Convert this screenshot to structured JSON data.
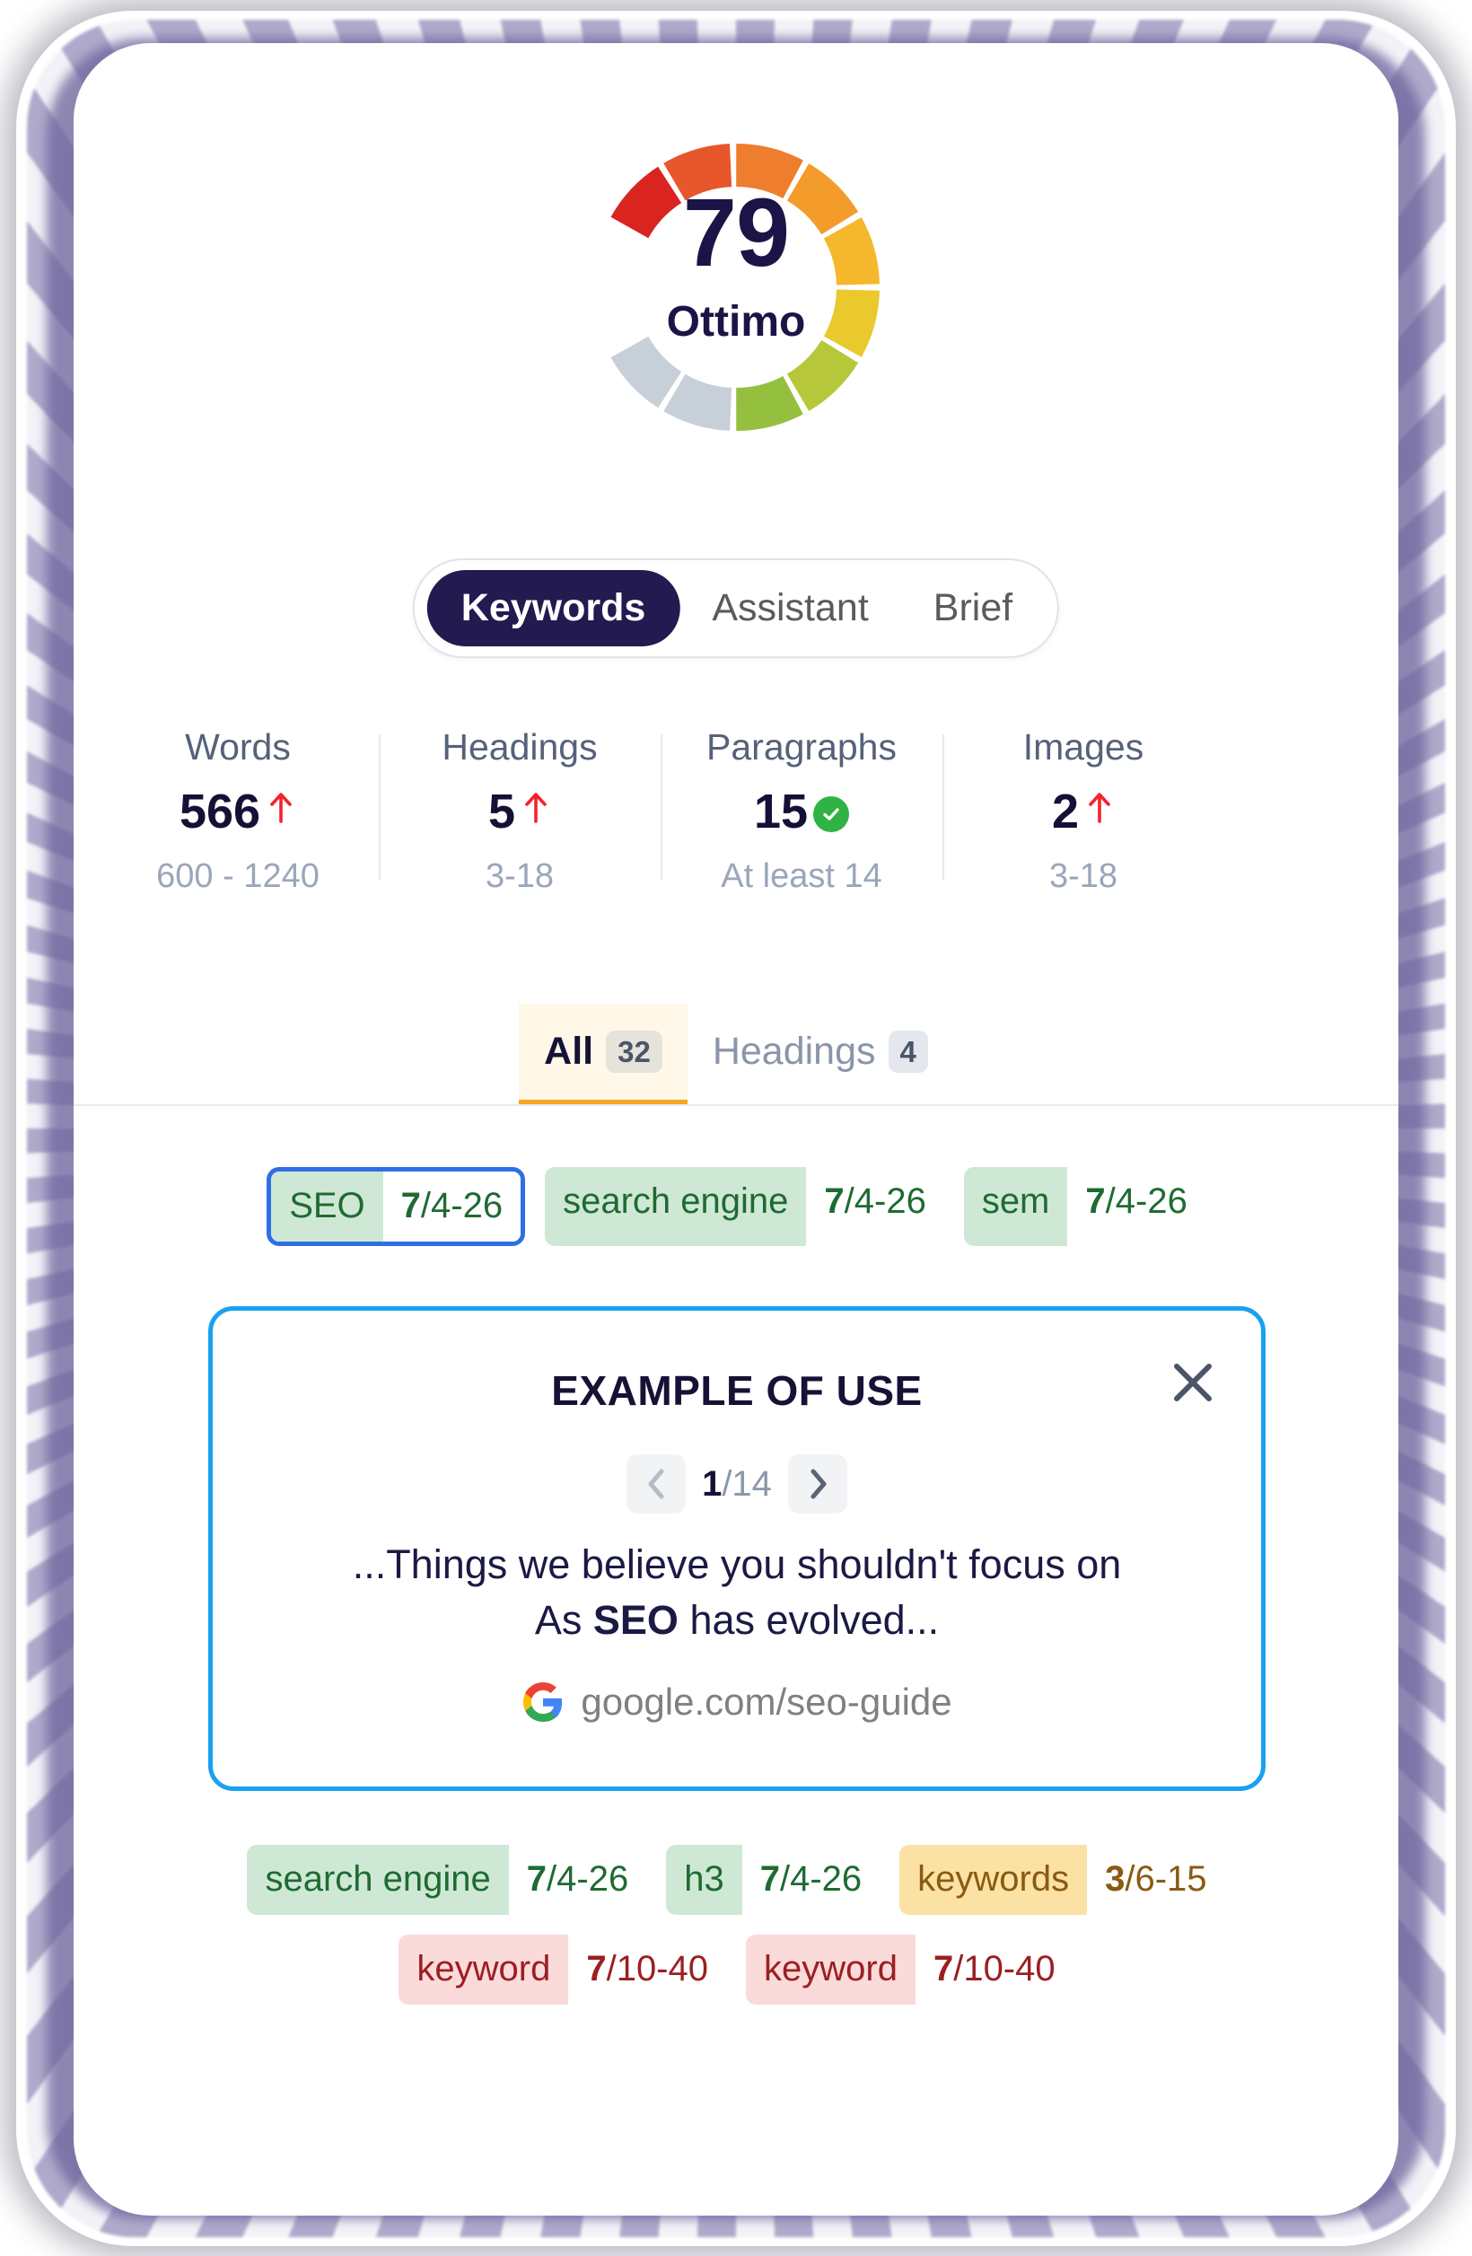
{
  "gauge": {
    "score": "79",
    "label": "Ottimo",
    "score_color": "#1b1547",
    "segments": [
      {
        "color": "#d92420"
      },
      {
        "color": "#e8562c"
      },
      {
        "color": "#ee7d2d"
      },
      {
        "color": "#f39c2b"
      },
      {
        "color": "#f5b72b"
      },
      {
        "color": "#e9c92c"
      },
      {
        "color": "#b6c83a"
      },
      {
        "color": "#95bf3f"
      },
      {
        "color": "#c7d0d8"
      },
      {
        "color": "#c7d0d8"
      }
    ],
    "filled_count": 8
  },
  "tabs": [
    {
      "label": "Keywords",
      "active": true
    },
    {
      "label": "Assistant",
      "active": false
    },
    {
      "label": "Brief",
      "active": false
    }
  ],
  "stats": [
    {
      "name": "Words",
      "value": "566",
      "indicator": "arrow-up-icon",
      "range": "600 - 1240"
    },
    {
      "name": "Headings",
      "value": "5",
      "indicator": "arrow-up-icon",
      "range": "3-18"
    },
    {
      "name": "Paragraphs",
      "value": "15",
      "indicator": "check-circle-icon",
      "range": "At least 14"
    },
    {
      "name": "Images",
      "value": "2",
      "indicator": "arrow-up-icon",
      "range": "3-18"
    }
  ],
  "filters": [
    {
      "label": "All",
      "count": "32",
      "active": true
    },
    {
      "label": "Headings",
      "count": "4",
      "active": false
    }
  ],
  "chip_rows": [
    [
      {
        "term": "SEO",
        "used": "7",
        "target": "/4-26",
        "tone": "green",
        "selected": true
      },
      {
        "term": "search engine",
        "used": "7",
        "target": "/4-26",
        "tone": "green",
        "selected": false
      },
      {
        "term": "sem",
        "used": "7",
        "target": "/4-26",
        "tone": "green",
        "selected": false
      }
    ],
    [
      {
        "term": "search engine",
        "used": "7",
        "target": "/4-26",
        "tone": "green",
        "selected": false
      },
      {
        "term": "h3",
        "used": "7",
        "target": "/4-26",
        "tone": "green",
        "selected": false
      },
      {
        "term": "keywords",
        "used": "3",
        "target": "/6-15",
        "tone": "amber",
        "selected": false
      }
    ],
    [
      {
        "term": "keyword",
        "used": "7",
        "target": "/10-40",
        "tone": "red",
        "selected": false
      },
      {
        "term": "keyword",
        "used": "7",
        "target": "/10-40",
        "tone": "red",
        "selected": false
      }
    ]
  ],
  "popover": {
    "title": "EXAMPLE OF USE",
    "close_icon": "close-icon",
    "prev_icon": "chevron-left-icon",
    "next_icon": "chevron-right-icon",
    "page_current": "1",
    "page_total": "/14",
    "body_line_1": "...Things we believe you shouldn't focus on",
    "body_line_2_pre": "As ",
    "body_line_2_kw": "SEO",
    "body_line_2_post": " has evolved...",
    "source_icon": "google-logo-icon",
    "source_url": "google.com/seo-guide",
    "border_color": "#1aa1f0"
  },
  "theme": {
    "accent_navy": "#231a50",
    "accent_orange": "#f6a723",
    "selection_blue": "#2f6fe4",
    "green": "#1e6b32",
    "amber": "#8a5a10",
    "red": "#9c1f22"
  }
}
